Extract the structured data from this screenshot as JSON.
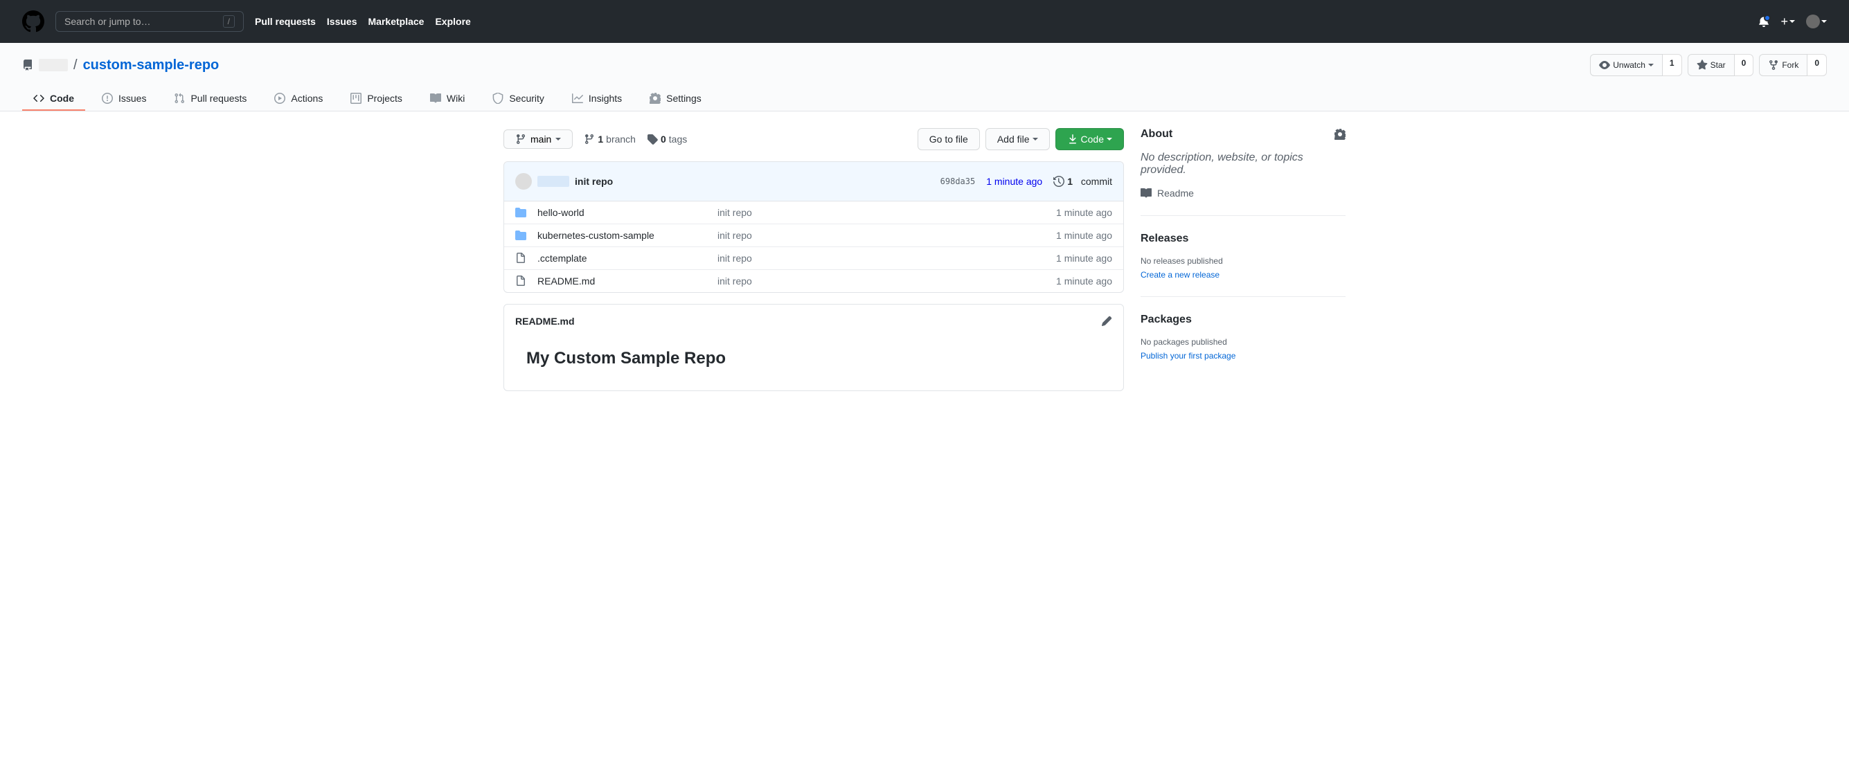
{
  "header": {
    "search_placeholder": "Search or jump to…",
    "search_key": "/",
    "nav": [
      "Pull requests",
      "Issues",
      "Marketplace",
      "Explore"
    ]
  },
  "repo": {
    "name": "custom-sample-repo",
    "separator": "/"
  },
  "actions": {
    "unwatch": {
      "label": "Unwatch",
      "count": "1"
    },
    "star": {
      "label": "Star",
      "count": "0"
    },
    "fork": {
      "label": "Fork",
      "count": "0"
    }
  },
  "tabs": [
    {
      "label": "Code"
    },
    {
      "label": "Issues"
    },
    {
      "label": "Pull requests"
    },
    {
      "label": "Actions"
    },
    {
      "label": "Projects"
    },
    {
      "label": "Wiki"
    },
    {
      "label": "Security"
    },
    {
      "label": "Insights"
    },
    {
      "label": "Settings"
    }
  ],
  "branch": {
    "current": "main",
    "branches_count": "1",
    "branches_label": "branch",
    "tags_count": "0",
    "tags_label": "tags"
  },
  "buttons": {
    "go_to_file": "Go to file",
    "add_file": "Add file",
    "code": "Code"
  },
  "latest_commit": {
    "message": "init repo",
    "sha": "698da35",
    "time": "1 minute ago",
    "commits_count": "1",
    "commits_label": "commit"
  },
  "files": [
    {
      "type": "dir",
      "name": "hello-world",
      "commit": "init repo",
      "time": "1 minute ago"
    },
    {
      "type": "dir",
      "name": "kubernetes-custom-sample",
      "commit": "init repo",
      "time": "1 minute ago"
    },
    {
      "type": "file",
      "name": ".cctemplate",
      "commit": "init repo",
      "time": "1 minute ago"
    },
    {
      "type": "file",
      "name": "README.md",
      "commit": "init repo",
      "time": "1 minute ago"
    }
  ],
  "readme": {
    "filename": "README.md",
    "heading": "My Custom Sample Repo"
  },
  "sidebar": {
    "about": {
      "title": "About",
      "description": "No description, website, or topics provided.",
      "readme": "Readme"
    },
    "releases": {
      "title": "Releases",
      "empty": "No releases published",
      "action": "Create a new release"
    },
    "packages": {
      "title": "Packages",
      "empty": "No packages published",
      "action": "Publish your first package"
    }
  }
}
